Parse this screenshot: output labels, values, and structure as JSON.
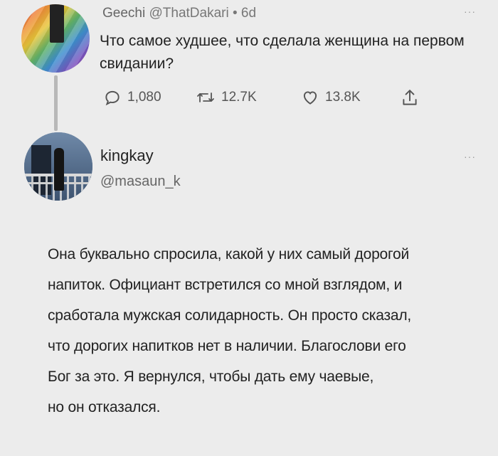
{
  "tweet1": {
    "name": "Geechi",
    "handle": "@ThatDakari",
    "separator": "•",
    "time": "6d",
    "text": "Что самое худшее, что сделала женщина на первом свидании?",
    "more": "···",
    "stats": {
      "replies": "1,080",
      "retweets": "12.7K",
      "likes": "13.8K"
    }
  },
  "tweet2": {
    "name": "kingkay",
    "handle": "@masaun_k",
    "more": "···",
    "lines": [
      "Она буквально спросила, какой у них самый дорогой",
      "напиток. Официант встретился со мной взглядом, и",
      "сработала мужская солидарность. Он просто сказал,",
      "что дорогих напитков нет в наличии. Благослови его",
      "Бог за это. Я вернулся, чтобы дать ему чаевые,",
      "но он отказался."
    ]
  },
  "colors": {
    "background": "#ececec",
    "text": "#222222",
    "muted": "#666666",
    "thread_line": "#b8b8b8"
  },
  "icons": [
    "reply-icon",
    "retweet-icon",
    "like-icon",
    "share-icon",
    "more-icon"
  ]
}
